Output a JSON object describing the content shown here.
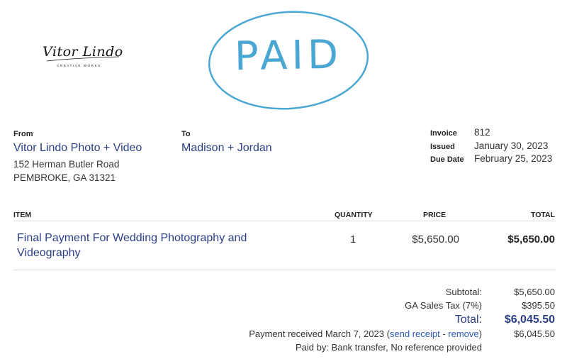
{
  "logo": {
    "script_text": "Vitor Lindo",
    "sub_text": "CREATIVE WORKS"
  },
  "stamp": {
    "text": "PAID",
    "color": "#4aa7d4"
  },
  "from": {
    "label": "From",
    "name": "Vitor Lindo Photo + Video",
    "address_line1": "152 Herman Butler Road",
    "address_line2": "PEMBROKE, GA 31321"
  },
  "to": {
    "label": "To",
    "name": "Madison + Jordan"
  },
  "meta": {
    "invoice_label": "Invoice",
    "invoice_value": "812",
    "issued_label": "Issued",
    "issued_value": "January 30, 2023",
    "due_label": "Due Date",
    "due_value": "February 25, 2023"
  },
  "table": {
    "headers": {
      "item": "ITEM",
      "quantity": "QUANTITY",
      "price": "PRICE",
      "total": "TOTAL"
    },
    "rows": [
      {
        "item": "Final Payment For Wedding Photography and Videography",
        "quantity": "1",
        "price": "$5,650.00",
        "total": "$5,650.00"
      }
    ]
  },
  "summary": {
    "subtotal_label": "Subtotal:",
    "subtotal_value": "$5,650.00",
    "tax_label": "GA Sales Tax (7%)",
    "tax_value": "$395.50",
    "total_label": "Total:",
    "total_value": "$6,045.50",
    "payment_prefix": "Payment received March 7, 2023 (",
    "send_receipt": "send receipt",
    "dash": " - ",
    "remove": "remove",
    "payment_suffix": ")",
    "payment_value": "$6,045.50",
    "paid_by": "Paid by: Bank transfer, No reference provided"
  },
  "colors": {
    "accent": "#2b3f86",
    "link": "#2b5db8",
    "stamp": "#4aa7d4"
  }
}
